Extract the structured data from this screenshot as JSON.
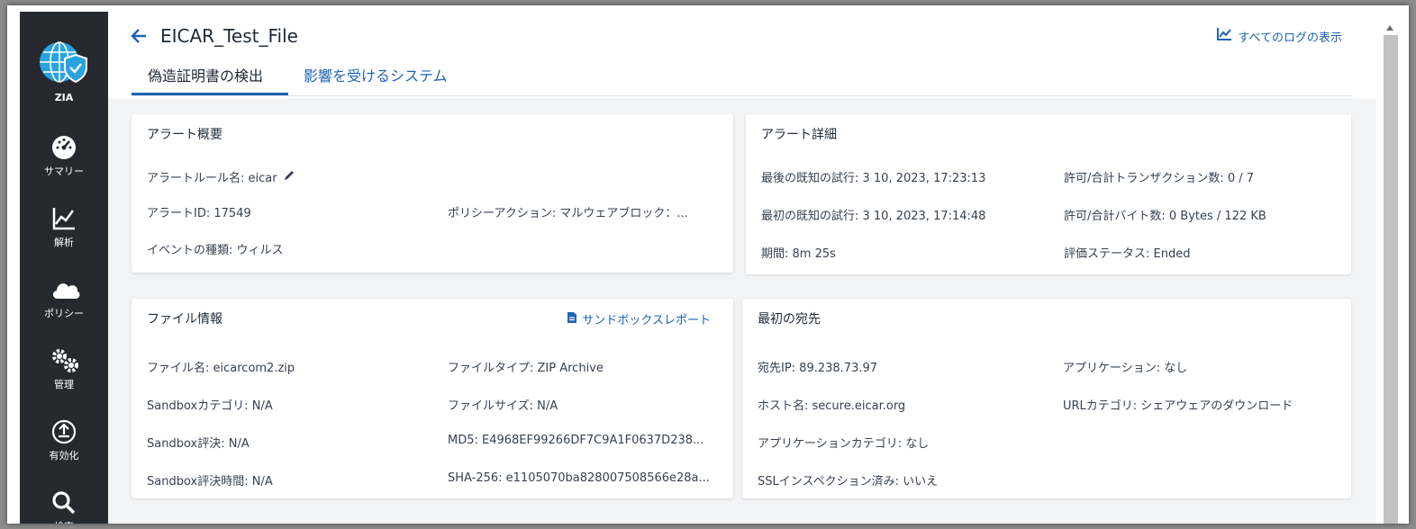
{
  "sidebar": {
    "logo_label": "ZIA",
    "items": [
      {
        "label": "サマリー",
        "icon": "dashboard-icon"
      },
      {
        "label": "解析",
        "icon": "analytics-icon"
      },
      {
        "label": "ポリシー",
        "icon": "cloud-icon"
      },
      {
        "label": "管理",
        "icon": "gears-icon"
      },
      {
        "label": "有効化",
        "icon": "upload-icon"
      },
      {
        "label": "検索",
        "icon": "search-icon"
      }
    ]
  },
  "header": {
    "title": "EICAR_Test_File",
    "log_link": "すべてのログの表示",
    "tabs": [
      {
        "label": "偽造証明書の検出",
        "active": true
      },
      {
        "label": "影響を受けるシステム",
        "active": false
      }
    ]
  },
  "alert_summary": {
    "title": "アラート概要",
    "rule_name": "アラートルール名: eicar",
    "alert_id": "アラートID: 17549",
    "policy_action": "ポリシーアクション: マルウェアブロック：...",
    "event_type": "イベントの種類: ウィルス"
  },
  "alert_details": {
    "title": "アラート詳細",
    "last_attempt": "最後の既知の試行: 3 10, 2023, 17:23:13",
    "first_attempt": "最初の既知の試行: 3 10, 2023, 17:14:48",
    "duration": "期間: 8m 25s",
    "transactions": "許可/合計トランザクション数: 0 / 7",
    "bytes": "許可/合計バイト数: 0 Bytes / 122 KB",
    "status": "評価ステータス: Ended"
  },
  "file_info": {
    "title": "ファイル情報",
    "sandbox_report": "サンドボックスレポート",
    "file_name": "ファイル名: eicarcom2.zip",
    "sandbox_category": "Sandboxカテゴリ: N/A",
    "sandbox_verdict": "Sandbox評決: N/A",
    "sandbox_time": "Sandbox評決時間: N/A",
    "file_type": "ファイルタイプ: ZIP Archive",
    "file_size": "ファイルサイズ: N/A",
    "md5": "MD5: E4968EF99266DF7C9A1F0637D238...",
    "sha256": "SHA-256: e1105070ba828007508566e28a..."
  },
  "first_destination": {
    "title": "最初の宛先",
    "dest_ip": "宛先IP: 89.238.73.97",
    "hostname": "ホスト名: secure.eicar.org",
    "app_category": "アプリケーションカテゴリ: なし",
    "ssl": "SSLインスペクション済み: いいえ",
    "application": "アプリケーション: なし",
    "url_category": "URLカテゴリ: シェアウェアのダウンロード"
  },
  "colors": {
    "sidebar_bg": "#262a30",
    "accent": "#1e63b5",
    "logo_blue": "#29a3e0"
  }
}
